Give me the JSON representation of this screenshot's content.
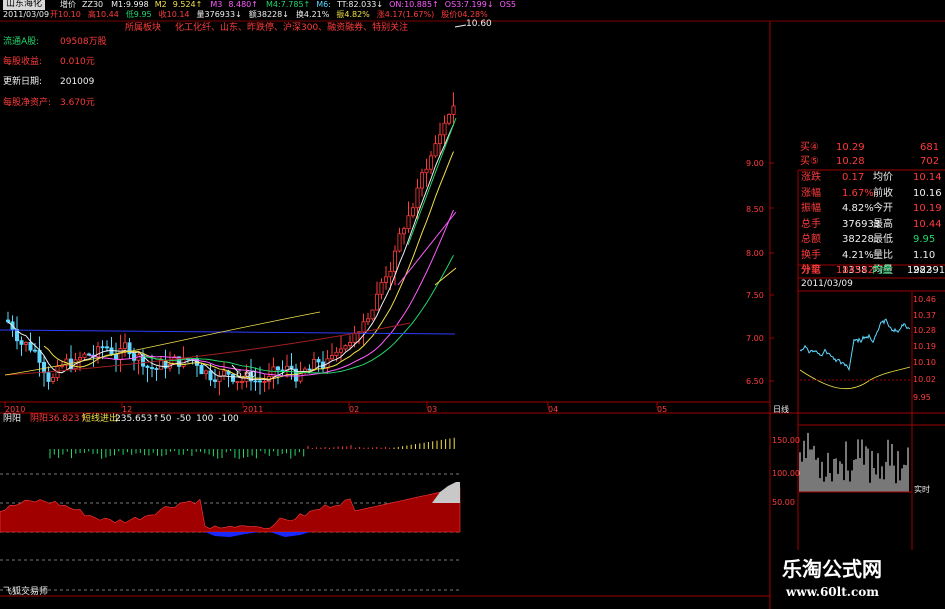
{
  "header": {
    "stock_name": "山东海化",
    "row1": [
      {
        "label": "增价",
        "value": "ZZ30",
        "color": "#f0f0f0"
      },
      {
        "label": "M1:9.998",
        "value": "",
        "color": "#f0f0f0"
      },
      {
        "label": "M2",
        "value": "9.524↑",
        "color": "#f2e14a"
      },
      {
        "label": "M3",
        "value": "8.480↑",
        "color": "#ff5cff"
      },
      {
        "label": "M4:7.785↑",
        "value": "",
        "color": "#23d66a"
      },
      {
        "label": "M6:",
        "value": "",
        "color": "#5fd7ff"
      },
      {
        "label": "TT:82.033↓",
        "value": "",
        "color": "#f0f0f0"
      },
      {
        "label": "ON:10.885↑",
        "value": "",
        "color": "#ff5cff"
      },
      {
        "label": "OS3:7.199↓",
        "value": "",
        "color": "#ff5cff"
      },
      {
        "label": "OS5",
        "value": "",
        "color": "#ff5cff"
      }
    ],
    "row2": [
      {
        "text": "开10.10",
        "color": "#ff3b3b"
      },
      {
        "text": "高10.44",
        "color": "#ff3b3b"
      },
      {
        "text": "低9.95",
        "color": "#23d66a"
      },
      {
        "text": "收10.14",
        "color": "#ff3b3b"
      },
      {
        "text": "量376933↓",
        "color": "#f0f0f0"
      },
      {
        "text": "额38228↓",
        "color": "#f0f0f0"
      },
      {
        "text": "换4.21%",
        "color": "#f0f0f0"
      },
      {
        "text": "振4.82%",
        "color": "#f2e14a"
      },
      {
        "text": "涨4.17(1.67%)",
        "color": "#ff3b3b"
      },
      {
        "text": "股价04.28%",
        "color": "#ff3b3b"
      }
    ],
    "date": "2011/03/09",
    "industry": "所属板块",
    "concepts": "化工化纤、山东、昨跌停、沪深300、融资融券、特别关注"
  },
  "info_panel": [
    {
      "label": "流通A股:",
      "value": "09508万股",
      "label_color": "#23d66a"
    },
    {
      "label": "每股收益:",
      "value": "0.010元",
      "label_color": "#ff3b3b"
    },
    {
      "label": "更新日期:",
      "value": "201009",
      "label_color": "#f0f0f0"
    },
    {
      "label": "每股净资产:",
      "value": "3.670元",
      "label_color": "#ff3b3b"
    }
  ],
  "price_annotations": {
    "high": "10.60",
    "low": "6.60"
  },
  "time_axis": [
    "2010",
    "12",
    "2011",
    "02",
    "03",
    "04",
    "05",
    "日线"
  ],
  "indicator": {
    "name": "阴阳",
    "line1_label": "阴阳",
    "line1_value": "36.823↑",
    "line2_label": "短线进出:",
    "line2_value": "235.653↑",
    "levels": [
      "50",
      "-50",
      "100",
      "-100"
    ]
  },
  "footer_label": "飞狐交易师",
  "quote_panel": {
    "bids": [
      {
        "label": "买④",
        "price": "10.29",
        "vol": "681"
      },
      {
        "label": "买⑤",
        "price": "10.28",
        "vol": "702"
      }
    ],
    "stats": [
      {
        "l1": "涨跌",
        "v1": "0.17",
        "l2": "均价",
        "v2": "10.14"
      },
      {
        "l1": "涨幅",
        "v1": "1.67%",
        "l2": "前收",
        "v2": "10.16"
      },
      {
        "l1": "振幅",
        "v1": "4.82%",
        "l2": "今开",
        "v2": "10.19"
      },
      {
        "l1": "总手",
        "v1": "376933",
        "l2": "最高",
        "v2": "10.44"
      },
      {
        "l1": "总额",
        "v1": "38228",
        "l2": "最低",
        "v2": "9.95"
      },
      {
        "l1": "换手",
        "v1": "4.21%",
        "l2": "量比",
        "v2": "1.10"
      },
      {
        "l1": "分笔",
        "v1": "1338",
        "l2": "均量",
        "v2": "282"
      }
    ],
    "outer_label": "外盘",
    "outer_value": "184542",
    "inner_label": "内盘",
    "inner_value": "192391",
    "intraday_date": "2011/03/09",
    "intraday_left_ticks": [
      "10.46",
      "10.37",
      "10.28",
      "10.19",
      "10.10",
      "10.02",
      "9.95"
    ],
    "price_axis": [
      "9.00",
      "8.50",
      "8.00",
      "7.50",
      "7.00",
      "6.50"
    ],
    "volume_axis": [
      "150.00",
      "100.00",
      "50.00"
    ],
    "volume_label": "实时"
  },
  "watermark": {
    "title": "乐淘公式网",
    "url": "www.60lt.com"
  }
}
